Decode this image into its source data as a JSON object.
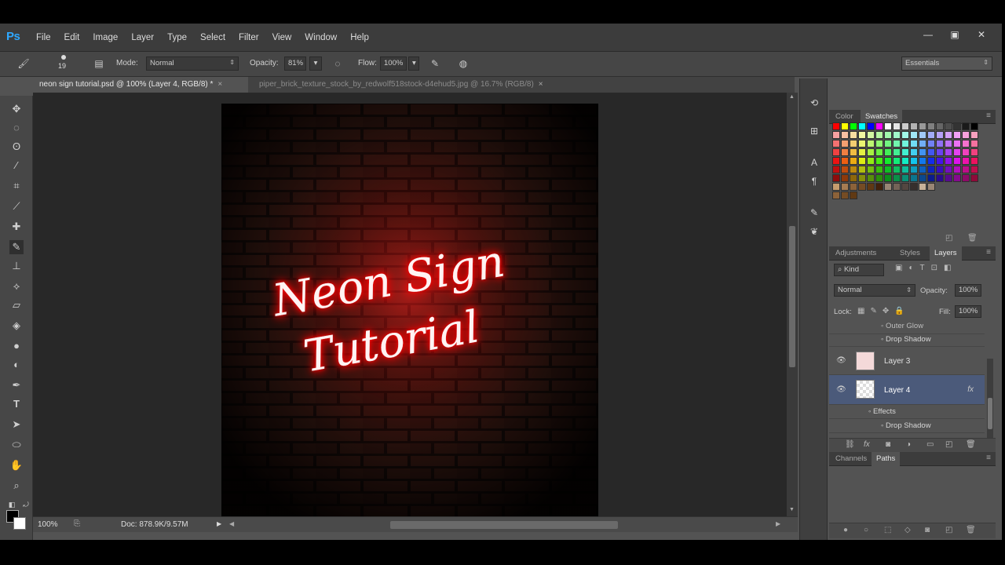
{
  "app": {
    "logo": "Ps",
    "menu": [
      "File",
      "Edit",
      "Image",
      "Layer",
      "Type",
      "Select",
      "Filter",
      "View",
      "Window",
      "Help"
    ],
    "window_controls": {
      "minimize": "—",
      "restore": "▣",
      "close": "✕"
    }
  },
  "options": {
    "brush_size": "19",
    "mode_label": "Mode:",
    "mode_value": "Normal",
    "opacity_label": "Opacity:",
    "opacity_value": "81%",
    "flow_label": "Flow:",
    "flow_value": "100%",
    "workspace": "Essentials"
  },
  "tabs": [
    {
      "label": "neon sign tutorial.psd @ 100% (Layer 4, RGB/8) *",
      "active": true
    },
    {
      "label": "piper_brick_texture_stock_by_redwolf518stock-d4ehud5.jpg @ 16.7% (RGB/8)",
      "active": false
    }
  ],
  "canvas": {
    "line1": "Neon Sign",
    "line2": "Tutorial",
    "neon_color": "#ff2020"
  },
  "status": {
    "zoom": "100%",
    "doc": "Doc: 878.9K/9.57M"
  },
  "panels": {
    "top_tabs": [
      "Color",
      "Swatches"
    ],
    "mid_tabs": [
      "Adjustments",
      "Styles",
      "Layers"
    ],
    "bottom_tabs": [
      "Channels",
      "Paths"
    ],
    "filter_kind": "Kind",
    "blend_mode": "Normal",
    "opacity_label": "Opacity:",
    "opacity_value": "100%",
    "lock_label": "Lock:",
    "fill_label": "Fill:",
    "fill_value": "100%",
    "layers": {
      "partial_effect": "Outer Glow",
      "effect_drop_shadow_top": "Drop Shadow",
      "layer3": "Layer 3",
      "layer4": "Layer 4",
      "layer4_fx": "fx",
      "effects": "Effects",
      "effect_drop_shadow": "Drop Shadow"
    }
  }
}
